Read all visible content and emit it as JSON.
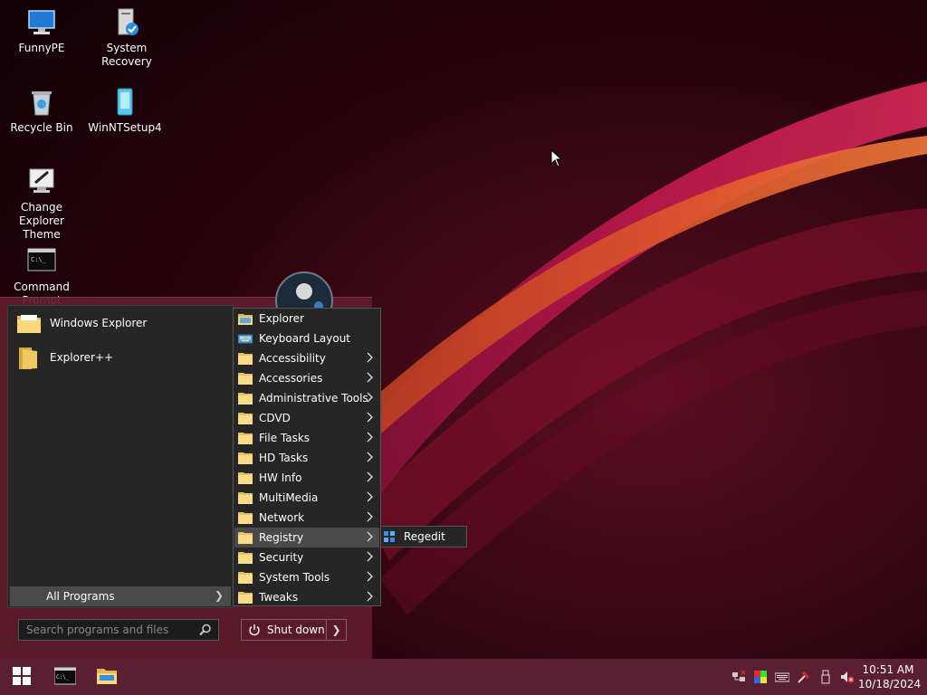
{
  "desktop": {
    "icons": [
      {
        "label": "FunnyPE"
      },
      {
        "label": "System Recovery"
      },
      {
        "label": "Recycle Bin"
      },
      {
        "label": "WinNTSetup4"
      },
      {
        "label": "Change Explorer Theme"
      },
      {
        "label": "Command Prompt"
      }
    ]
  },
  "start_menu": {
    "pinned": [
      {
        "label": "Windows Explorer"
      },
      {
        "label": "Explorer++"
      }
    ],
    "all_programs_label": "All Programs",
    "search_placeholder": "Search programs and files",
    "shutdown_label": "Shut down"
  },
  "programs_menu": {
    "items": [
      {
        "label": "Explorer"
      },
      {
        "label": "Keyboard Layout"
      },
      {
        "label": "Accessibility"
      },
      {
        "label": "Accessories"
      },
      {
        "label": "Administrative Tools"
      },
      {
        "label": "CDVD"
      },
      {
        "label": "File Tasks"
      },
      {
        "label": "HD Tasks"
      },
      {
        "label": "HW Info"
      },
      {
        "label": "MultiMedia"
      },
      {
        "label": "Network"
      },
      {
        "label": "Registry"
      },
      {
        "label": "Security"
      },
      {
        "label": "System Tools"
      },
      {
        "label": "Tweaks"
      }
    ],
    "selected": "Registry"
  },
  "registry_submenu": {
    "items": [
      {
        "label": "Regedit"
      }
    ]
  },
  "taskbar": {
    "time": "10:51 AM",
    "date": "10/18/2024"
  },
  "colors": {
    "accent": "#5a1f33",
    "menu_bg": "#262626",
    "selected_bg": "#4a4a4a"
  }
}
